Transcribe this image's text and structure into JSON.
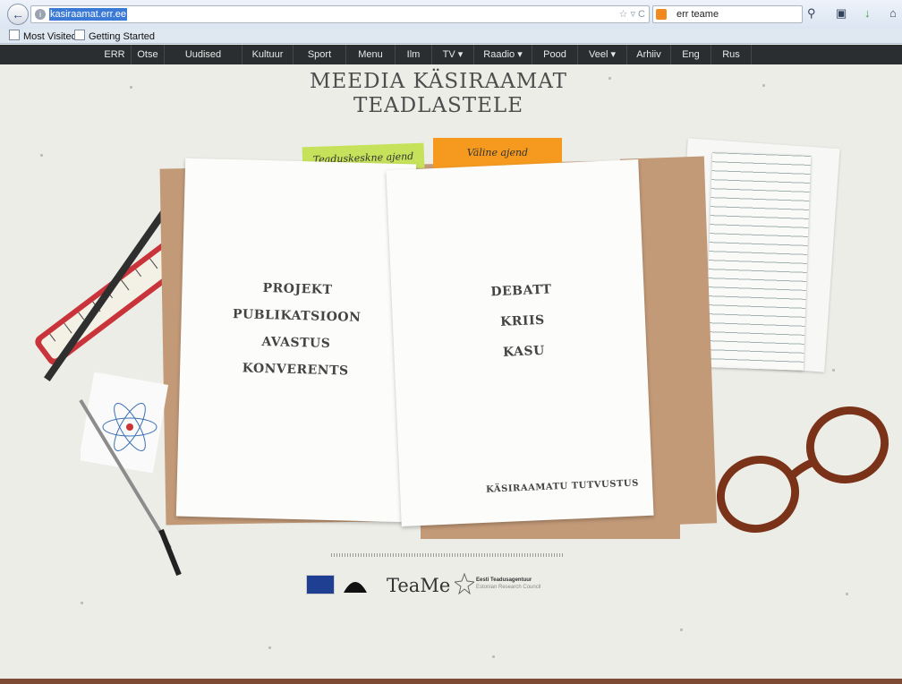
{
  "browser": {
    "url": "kasiraamat.err.ee",
    "search_query": "err teame",
    "bookmarks": [
      "Most Visited",
      "Getting Started"
    ]
  },
  "nav": {
    "items": [
      "ERR",
      "Otse",
      "Uudised",
      "Kultuur",
      "Sport",
      "Menu",
      "Ilm",
      "TV ▾",
      "Raadio ▾",
      "Pood",
      "Veel ▾",
      "Arhiiv",
      "Eng",
      "Rus"
    ]
  },
  "page": {
    "title_line1": "MEEDIA KÄSIRAAMAT",
    "title_line2": "TEADLASTELE",
    "tab_left": "Teaduskeskne ajend",
    "tab_right": "Väline ajend",
    "left_topics": [
      "PROJEKT",
      "PUBLIKATSIOON",
      "AVASTUS",
      "KONVERENTS"
    ],
    "right_topics": [
      "DEBATT",
      "KRIIS",
      "KASU"
    ],
    "intro_link": "KÄSIRAAMATU TUTVUSTUS",
    "footer_teame": "TeaMe",
    "footer_etag_line1": "Eesti Teadusagentuur",
    "footer_etag_line2": "Estonian Research Council"
  },
  "colors": {
    "nav_bg": "#2b2e31",
    "tab_green": "#c6e25a",
    "tab_orange": "#f59a1f",
    "folder": "#c39a78"
  }
}
